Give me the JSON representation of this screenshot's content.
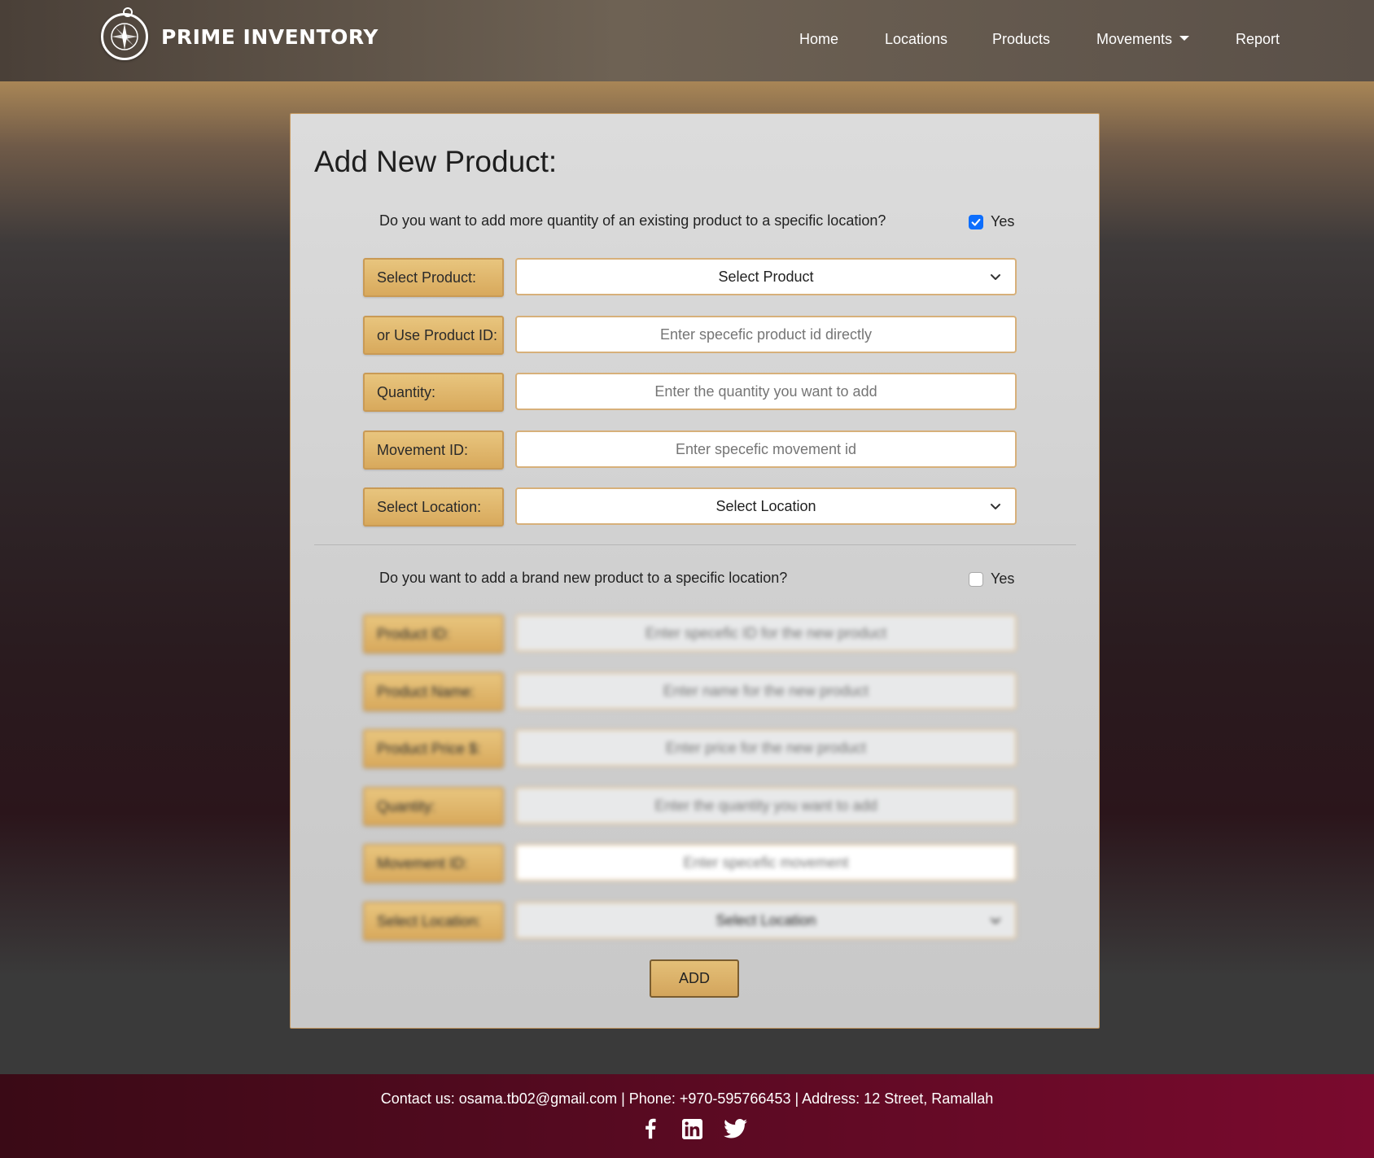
{
  "brand": {
    "name": "PRIME INVENTORY",
    "logo_icon": "compass-icon"
  },
  "nav": {
    "items": [
      {
        "label": "Home"
      },
      {
        "label": "Locations"
      },
      {
        "label": "Products"
      },
      {
        "label": "Movements",
        "has_dropdown": true
      },
      {
        "label": "Report"
      }
    ]
  },
  "form": {
    "title": "Add New Product:",
    "existing": {
      "question": "Do you want to add more quantity of an existing product to a specific location?",
      "yes_label": "Yes",
      "checked": true,
      "product_label": "Select Product:",
      "product_select": "Select Product",
      "product_id_label": "or Use Product ID:",
      "product_id_placeholder": "Enter specefic product id directly",
      "quantity_label": "Quantity:",
      "quantity_placeholder": "Enter the quantity you want to add",
      "movement_label": "Movement ID:",
      "movement_placeholder": "Enter specefic movement id",
      "location_label": "Select Location:",
      "location_select": "Select Location"
    },
    "brand_new": {
      "question": "Do you want to add a brand new product to a specific location?",
      "yes_label": "Yes",
      "checked": false,
      "product_id_label": "Product ID:",
      "product_id_placeholder": "Enter specefic ID for the new product",
      "name_label": "Product Name:",
      "name_placeholder": "Enter name for the new product",
      "price_label": "Product Price $:",
      "price_placeholder": "Enter price for the new product",
      "quantity_label": "Quantity:",
      "quantity_placeholder": "Enter the quantity you want to add",
      "movement_label": "Movement ID:",
      "movement_placeholder": "Enter specefic movement",
      "location_label": "Select Location:",
      "location_select": "Select Location"
    },
    "add_button": "ADD"
  },
  "footer": {
    "contact": "Contact us: osama.tb02@gmail.com | Phone: +970-595766453 | Address: 12 Street, Ramallah",
    "socials": [
      "facebook-icon",
      "linkedin-icon",
      "twitter-icon"
    ]
  },
  "colors": {
    "accent_gold": "#d8a95c",
    "checkbox_blue": "#0d6efd",
    "footer_maroon": "#5a0a22"
  }
}
